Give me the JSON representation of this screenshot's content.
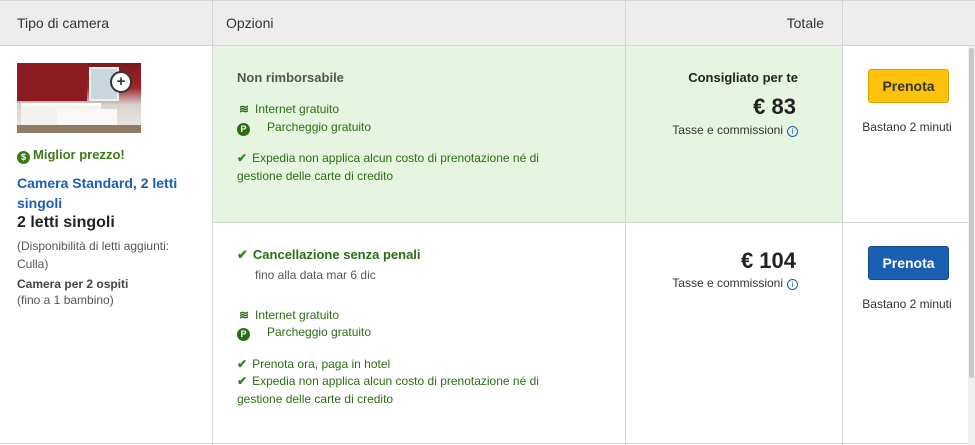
{
  "header": {
    "col_room": "Tipo di camera",
    "col_options": "Opzioni",
    "col_total": "Totale"
  },
  "room": {
    "best_price": "Miglior prezzo!",
    "best_price_icon": "dollar-coin-icon",
    "name": "Camera Standard, 2 letti singoli",
    "beds": "2 letti singoli",
    "availability": "(Disponibilità di letti aggiunti: Culla)",
    "guests": "Camera per 2 ospiti",
    "guests_sub": "(fino a 1 bambino)",
    "zoom_icon": "zoom-in-icon"
  },
  "offers": [
    {
      "title": "Non rimborsabile",
      "wifi": "Internet gratuito",
      "parking": "Parcheggio gratuito",
      "note": "Expedia non applica alcun costo di prenotazione né di gestione delle carte di credito",
      "recommended": "Consigliato per te",
      "price": "€ 83",
      "tax": "Tasse e commissioni",
      "button": "Prenota",
      "availability": "Bastano 2 minuti",
      "highlight_color": "#e6f5df"
    },
    {
      "title": "Cancellazione senza penali",
      "subtitle": "fino alla data mar 6 dic",
      "wifi": "Internet gratuito",
      "parking": "Parcheggio gratuito",
      "pay_later": "Prenota ora, paga in hotel",
      "note": "Expedia non applica alcun costo di prenotazione né di gestione delle carte di credito",
      "price": "€ 104",
      "tax": "Tasse e commissioni",
      "button": "Prenota",
      "availability": "Bastano 2 minuti"
    }
  ],
  "colors": {
    "green_text": "#2a6e14",
    "link_blue": "#1a5fb4",
    "button_yellow": "#fdc20c",
    "button_blue": "#1a5fb4"
  }
}
